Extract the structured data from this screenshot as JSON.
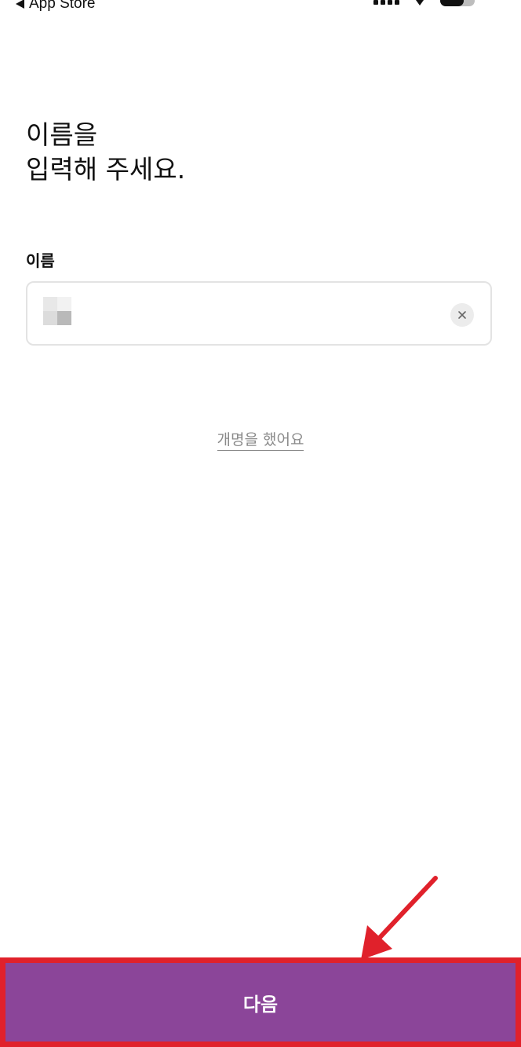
{
  "status_bar": {
    "back_label": "App Store"
  },
  "page": {
    "title": "이름을\n입력해 주세요."
  },
  "name_field": {
    "label": "이름",
    "value": ""
  },
  "links": {
    "renamed": "개명을 했어요"
  },
  "footer": {
    "next_label": "다음"
  },
  "colors": {
    "primary": "#8b4599",
    "annotation": "#e0212b"
  },
  "icons": {
    "clear": "close-icon",
    "back": "back-triangle-icon"
  }
}
